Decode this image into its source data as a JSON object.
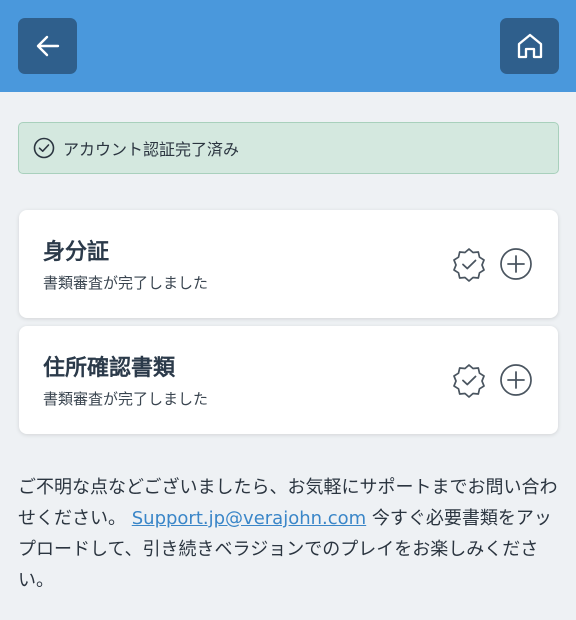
{
  "header": {
    "back_icon": "arrow-left-icon",
    "home_icon": "home-icon",
    "bar_color": "#4a98dc",
    "button_color": "#2f5f8c"
  },
  "banner": {
    "icon": "check-circle-icon",
    "text": "アカウント認証完了済み",
    "bg_color": "#d4e8df"
  },
  "documents": [
    {
      "title": "身分証",
      "status": "書類審査が完了しました",
      "badge_icon": "verified-badge-icon",
      "action_icon": "plus-circle-icon"
    },
    {
      "title": "住所確認書類",
      "status": "書類審査が完了しました",
      "badge_icon": "verified-badge-icon",
      "action_icon": "plus-circle-icon"
    }
  ],
  "footer": {
    "text_before": "ご不明な点などございましたら、お気軽にサポートまでお問い合わせください。 ",
    "email": "Support.jp@verajohn.com",
    "text_after": " 今すぐ必要書類をアップロードして、引き続きベラジョンでのプレイをお楽しみください。",
    "link_color": "#3a86c8"
  }
}
